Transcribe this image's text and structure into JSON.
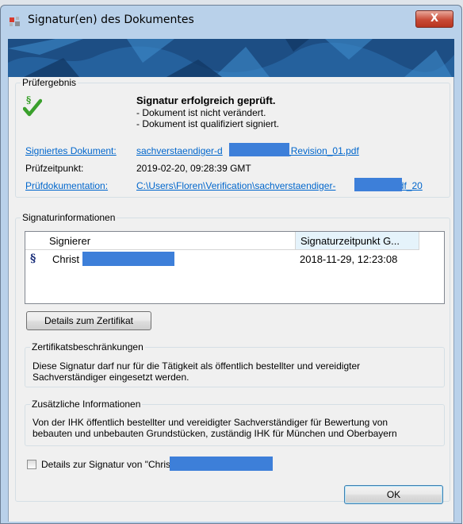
{
  "window": {
    "title": "Signatur(en) des Dokumentes",
    "close_glyph": "X"
  },
  "pruefergebnis": {
    "legend": "Prüfergebnis",
    "status_heading": "Signatur erfolgreich geprüft.",
    "status_lines": [
      "- Dokument ist nicht verändert.",
      "- Dokument ist qualifiziert signiert."
    ],
    "rows": [
      {
        "label": "Signiertes Dokument:",
        "value_prefix": "sachverstaendiger-d",
        "value_suffix": "t_Revision_01.pdf"
      },
      {
        "label": "Prüfzeitpunkt:",
        "value": "2019-02-20, 09:28:39 GMT"
      },
      {
        "label": "Prüfdokumentation:",
        "value_prefix": "C:\\Users\\Floren\\Verification\\sachverstaendiger-",
        "value_suffix": "st.pdf_20"
      }
    ]
  },
  "signaturinformationen": {
    "legend": "Signaturinformationen",
    "columns": [
      "Signierer",
      "Signaturzeitpunkt G..."
    ],
    "rows": [
      {
        "icon": "§",
        "signer_prefix": "Christ",
        "time": "2018-11-29, 12:23:08"
      }
    ],
    "details_button": "Details zum Zertifikat"
  },
  "zertifikatsbeschraenkungen": {
    "legend": "Zertifikatsbeschränkungen",
    "lines": [
      "Diese Signatur darf nur für die Tätigkeit als öffentlich bestellter und vereidigter",
      "Sachverständiger eingesetzt werden."
    ]
  },
  "zusaetzliche_informationen": {
    "legend": "Zusätzliche Informationen",
    "lines": [
      "Von der IHK öffentlich bestellter und vereidigter Sachverständiger für Bewertung von",
      "bebauten und unbebauten Grundstücken, zuständig IHK für München und Oberbayern"
    ]
  },
  "details_checkbox": {
    "label": "Details zur Signatur von \"Chris",
    "checked": false
  },
  "ok_button": "OK",
  "colors": {
    "banner": "#1d4e84",
    "link": "#0066cc",
    "check": "#3aa02c",
    "redaction": "#3d7fd9",
    "selected_column": "#e5f3fb"
  }
}
